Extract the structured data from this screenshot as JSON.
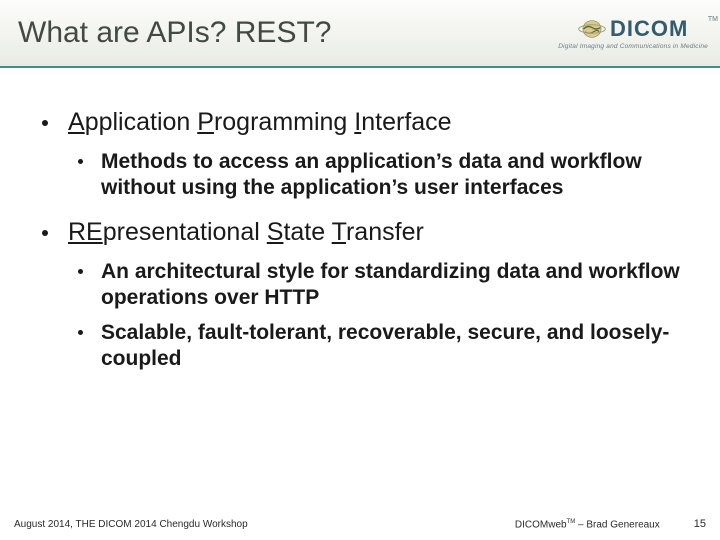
{
  "header": {
    "title": "What are APIs? REST?",
    "logo": {
      "brand": "DICOM",
      "tagline": "Digital Imaging and Communications in Medicine",
      "tm": "TM"
    }
  },
  "bullets": {
    "b1a_pre": "A",
    "b1a_mid1": "pplication ",
    "b1a_p": "P",
    "b1a_mid2": "rogramming ",
    "b1a_i": "I",
    "b1a_end": "nterface",
    "b1a_sub1": "Methods to access an application’s data and workflow without using the application’s user interfaces",
    "b1b_pre": "RE",
    "b1b_mid1": "presentational ",
    "b1b_s": "S",
    "b1b_mid2": "tate ",
    "b1b_t": "T",
    "b1b_end": "ransfer",
    "b1b_sub1": "An architectural style for standardizing data and workflow operations over HTTP",
    "b1b_sub2": "Scalable, fault-tolerant, recoverable, secure, and loosely-coupled"
  },
  "footer": {
    "left": "August 2014, THE DICOM 2014 Chengdu Workshop",
    "right_brand": "DICOMweb",
    "right_tm": "TM",
    "right_author": " – Brad Genereaux",
    "pagenum": "15"
  }
}
